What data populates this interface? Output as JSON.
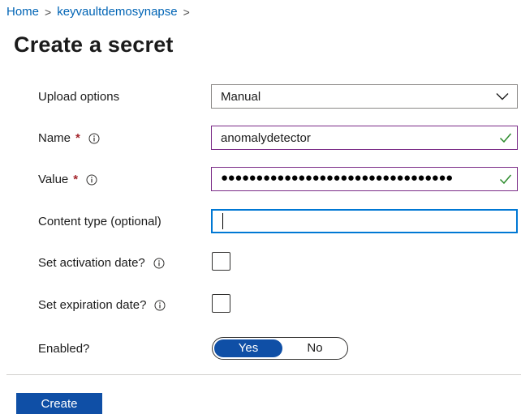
{
  "breadcrumb": {
    "items": [
      {
        "label": "Home"
      },
      {
        "label": "keyvaultdemosynapse"
      }
    ],
    "separator": ">"
  },
  "page": {
    "title": "Create a secret"
  },
  "form": {
    "upload_options": {
      "label": "Upload options",
      "value": "Manual"
    },
    "name": {
      "label": "Name",
      "required_mark": "*",
      "value": "anomalydetector",
      "valid": true
    },
    "value": {
      "label": "Value",
      "required_mark": "*",
      "masked_value": "●●●●●●●●●●●●●●●●●●●●●●●●●●●●●●●●●",
      "valid": true
    },
    "content_type": {
      "label": "Content type (optional)",
      "value": ""
    },
    "activation": {
      "label": "Set activation date?",
      "checked": false
    },
    "expiration": {
      "label": "Set expiration date?",
      "checked": false
    },
    "enabled": {
      "label": "Enabled?",
      "on_label": "Yes",
      "off_label": "No",
      "selected": "Yes"
    }
  },
  "actions": {
    "create_label": "Create"
  },
  "colors": {
    "link": "#0064b5",
    "primary": "#0f4fa6",
    "valid_border": "#7a2b87",
    "focus_border": "#0078d4",
    "check": "#2c8b2c",
    "required": "#a4262c"
  },
  "icons": [
    "info-icon",
    "checkmark-icon",
    "chevron-down-icon"
  ]
}
